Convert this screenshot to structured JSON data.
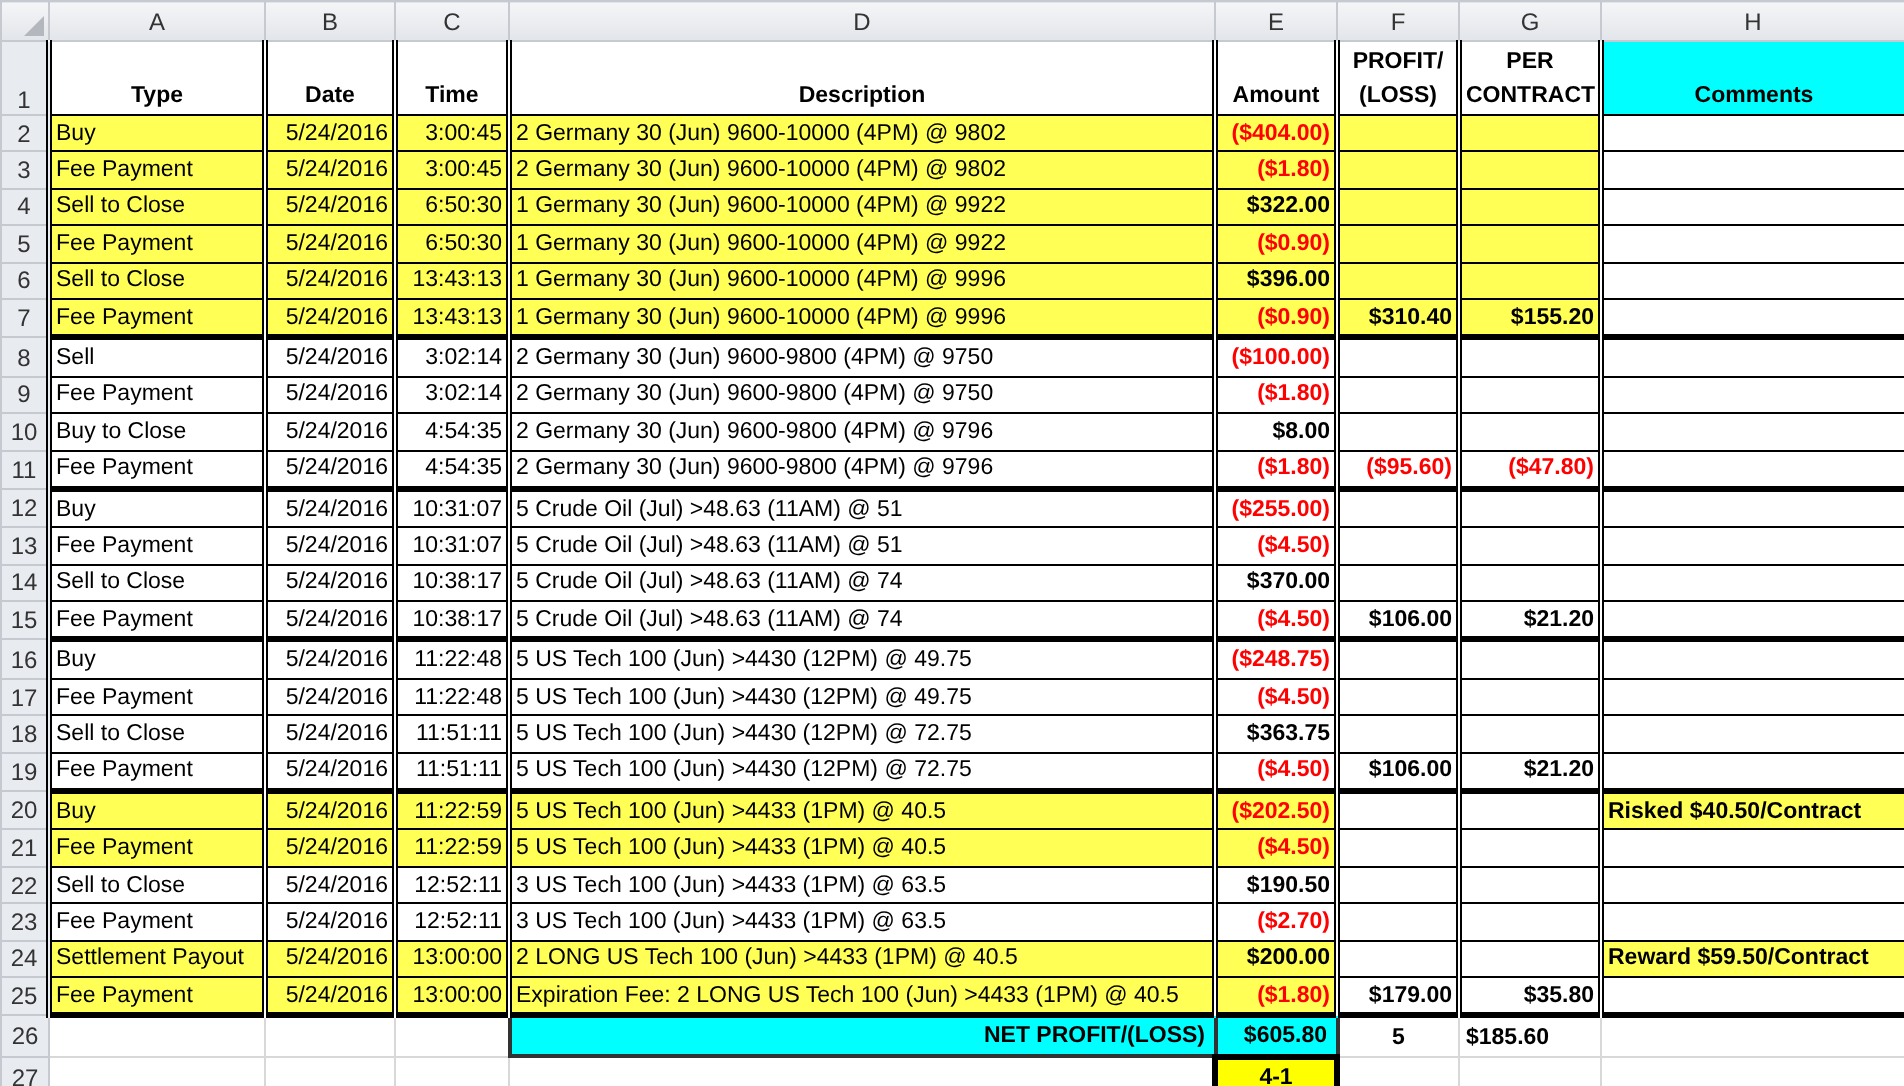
{
  "column_headers": [
    "A",
    "B",
    "C",
    "D",
    "E",
    "F",
    "G",
    "H"
  ],
  "header": {
    "number": "1",
    "cells": [
      {
        "lines": [
          "Type"
        ]
      },
      {
        "lines": [
          "Date"
        ]
      },
      {
        "lines": [
          "Time"
        ]
      },
      {
        "lines": [
          "Description"
        ]
      },
      {
        "lines": [
          "Amount"
        ]
      },
      {
        "lines": [
          "PROFIT/",
          "(LOSS)"
        ]
      },
      {
        "lines": [
          "PER",
          "CONTRACT"
        ]
      },
      {
        "lines": [
          "Comments"
        ]
      }
    ]
  },
  "groups": [
    {
      "rows": [
        {
          "number": "2",
          "type": "Buy",
          "date": "5/24/2016",
          "time": "3:00:45",
          "description": "2 Germany 30 (Jun) 9600-10000 (4PM) @ 9802",
          "amount": "($404.00)",
          "amount_negative": true,
          "highlighted": true,
          "profit_highlighted": true
        },
        {
          "number": "3",
          "type": "Fee Payment",
          "date": "5/24/2016",
          "time": "3:00:45",
          "description": "2 Germany 30 (Jun) 9600-10000 (4PM) @ 9802",
          "amount": "($1.80)",
          "amount_negative": true,
          "highlighted": true,
          "profit_highlighted": true
        },
        {
          "number": "4",
          "type": "Sell to Close",
          "date": "5/24/2016",
          "time": "6:50:30",
          "description": "1 Germany 30 (Jun) 9600-10000 (4PM) @ 9922",
          "amount": "$322.00",
          "amount_negative": false,
          "highlighted": true,
          "profit_highlighted": true
        },
        {
          "number": "5",
          "type": "Fee Payment",
          "date": "5/24/2016",
          "time": "6:50:30",
          "description": "1 Germany 30 (Jun) 9600-10000 (4PM) @ 9922",
          "amount": "($0.90)",
          "amount_negative": true,
          "highlighted": true,
          "profit_highlighted": true
        },
        {
          "number": "6",
          "type": "Sell to Close",
          "date": "5/24/2016",
          "time": "13:43:13",
          "description": "1 Germany 30 (Jun) 9600-10000 (4PM) @ 9996",
          "amount": "$396.00",
          "amount_negative": false,
          "highlighted": true,
          "profit_highlighted": true
        },
        {
          "number": "7",
          "type": "Fee Payment",
          "date": "5/24/2016",
          "time": "13:43:13",
          "description": "1 Germany 30 (Jun) 9600-10000 (4PM) @ 9996",
          "amount": "($0.90)",
          "amount_negative": true,
          "highlighted": true,
          "profit_highlighted": true,
          "profit": "$310.40",
          "per_contract": "$155.20",
          "profit_negative": false
        }
      ]
    },
    {
      "rows": [
        {
          "number": "8",
          "type": "Sell",
          "date": "5/24/2016",
          "time": "3:02:14",
          "description": "2 Germany 30 (Jun) 9600-9800 (4PM) @ 9750",
          "amount": "($100.00)",
          "amount_negative": true,
          "highlighted": false,
          "profit_highlighted": false
        },
        {
          "number": "9",
          "type": "Fee Payment",
          "date": "5/24/2016",
          "time": "3:02:14",
          "description": "2 Germany 30 (Jun) 9600-9800 (4PM) @ 9750",
          "amount": "($1.80)",
          "amount_negative": true,
          "highlighted": false,
          "profit_highlighted": false
        },
        {
          "number": "10",
          "type": "Buy to Close",
          "date": "5/24/2016",
          "time": "4:54:35",
          "description": "2 Germany 30 (Jun) 9600-9800 (4PM) @ 9796",
          "amount": "$8.00",
          "amount_negative": false,
          "highlighted": false,
          "profit_highlighted": false
        },
        {
          "number": "11",
          "type": "Fee Payment",
          "date": "5/24/2016",
          "time": "4:54:35",
          "description": "2 Germany 30 (Jun) 9600-9800 (4PM) @ 9796",
          "amount": "($1.80)",
          "amount_negative": true,
          "highlighted": false,
          "profit_highlighted": false,
          "profit": "($95.60)",
          "per_contract": "($47.80)",
          "profit_negative": true
        }
      ]
    },
    {
      "rows": [
        {
          "number": "12",
          "type": "Buy",
          "date": "5/24/2016",
          "time": "10:31:07",
          "description": "5 Crude Oil (Jul) >48.63 (11AM) @ 51",
          "amount": "($255.00)",
          "amount_negative": true,
          "highlighted": false,
          "profit_highlighted": false
        },
        {
          "number": "13",
          "type": "Fee Payment",
          "date": "5/24/2016",
          "time": "10:31:07",
          "description": "5 Crude Oil (Jul) >48.63 (11AM) @ 51",
          "amount": "($4.50)",
          "amount_negative": true,
          "highlighted": false,
          "profit_highlighted": false
        },
        {
          "number": "14",
          "type": "Sell to Close",
          "date": "5/24/2016",
          "time": "10:38:17",
          "description": "5 Crude Oil (Jul) >48.63 (11AM) @ 74",
          "amount": "$370.00",
          "amount_negative": false,
          "highlighted": false,
          "profit_highlighted": false
        },
        {
          "number": "15",
          "type": "Fee Payment",
          "date": "5/24/2016",
          "time": "10:38:17",
          "description": "5 Crude Oil (Jul) >48.63 (11AM) @ 74",
          "amount": "($4.50)",
          "amount_negative": true,
          "highlighted": false,
          "profit_highlighted": false,
          "profit": "$106.00",
          "per_contract": "$21.20",
          "profit_negative": false
        }
      ]
    },
    {
      "rows": [
        {
          "number": "16",
          "type": "Buy",
          "date": "5/24/2016",
          "time": "11:22:48",
          "description": "5 US Tech 100 (Jun) >4430 (12PM) @ 49.75",
          "amount": "($248.75)",
          "amount_negative": true,
          "highlighted": false,
          "profit_highlighted": false
        },
        {
          "number": "17",
          "type": "Fee Payment",
          "date": "5/24/2016",
          "time": "11:22:48",
          "description": "5 US Tech 100 (Jun) >4430 (12PM) @ 49.75",
          "amount": "($4.50)",
          "amount_negative": true,
          "highlighted": false,
          "profit_highlighted": false
        },
        {
          "number": "18",
          "type": "Sell to Close",
          "date": "5/24/2016",
          "time": "11:51:11",
          "description": "5 US Tech 100 (Jun) >4430 (12PM) @ 72.75",
          "amount": "$363.75",
          "amount_negative": false,
          "highlighted": false,
          "profit_highlighted": false
        },
        {
          "number": "19",
          "type": "Fee Payment",
          "date": "5/24/2016",
          "time": "11:51:11",
          "description": "5 US Tech 100 (Jun) >4430 (12PM) @ 72.75",
          "amount": "($4.50)",
          "amount_negative": true,
          "highlighted": false,
          "profit_highlighted": false,
          "profit": "$106.00",
          "per_contract": "$21.20",
          "profit_negative": false
        }
      ]
    },
    {
      "rows": [
        {
          "number": "20",
          "type": "Buy",
          "date": "5/24/2016",
          "time": "11:22:59",
          "description": "5 US Tech 100 (Jun) >4433 (1PM) @ 40.5",
          "amount": "($202.50)",
          "amount_negative": true,
          "highlighted": true,
          "profit_highlighted": false,
          "comment": "Risked $40.50/Contract"
        },
        {
          "number": "21",
          "type": "Fee Payment",
          "date": "5/24/2016",
          "time": "11:22:59",
          "description": "5 US Tech 100 (Jun) >4433 (1PM) @ 40.5",
          "amount": "($4.50)",
          "amount_negative": true,
          "highlighted": true,
          "profit_highlighted": false
        },
        {
          "number": "22",
          "type": "Sell to Close",
          "date": "5/24/2016",
          "time": "12:52:11",
          "description": "3 US Tech 100 (Jun) >4433 (1PM) @ 63.5",
          "amount": "$190.50",
          "amount_negative": false,
          "highlighted": false,
          "profit_highlighted": false
        },
        {
          "number": "23",
          "type": "Fee Payment",
          "date": "5/24/2016",
          "time": "12:52:11",
          "description": "3 US Tech 100 (Jun) >4433 (1PM) @ 63.5",
          "amount": "($2.70)",
          "amount_negative": true,
          "highlighted": false,
          "profit_highlighted": false
        },
        {
          "number": "24",
          "type": "Settlement Payout",
          "date": "5/24/2016",
          "time": "13:00:00",
          "description": "2 LONG US Tech 100 (Jun) >4433 (1PM) @ 40.5",
          "amount": "$200.00",
          "amount_negative": false,
          "highlighted": true,
          "profit_highlighted": false,
          "comment": "Reward $59.50/Contract"
        },
        {
          "number": "25",
          "type": "Fee Payment",
          "date": "5/24/2016",
          "time": "13:00:00",
          "description": "Expiration Fee: 2 LONG US Tech 100 (Jun) >4433 (1PM) @ 40.5",
          "amount": "($1.80)",
          "amount_negative": true,
          "highlighted": true,
          "profit_highlighted": false,
          "profit": "$179.00",
          "per_contract": "$35.80",
          "profit_negative": false
        }
      ]
    }
  ],
  "summary": {
    "number": "26",
    "label": "NET PROFIT/(LOSS)",
    "amount": "$605.80",
    "count": "5",
    "per_contract": "$185.60"
  },
  "record": {
    "number": "27",
    "value": "4-1"
  }
}
